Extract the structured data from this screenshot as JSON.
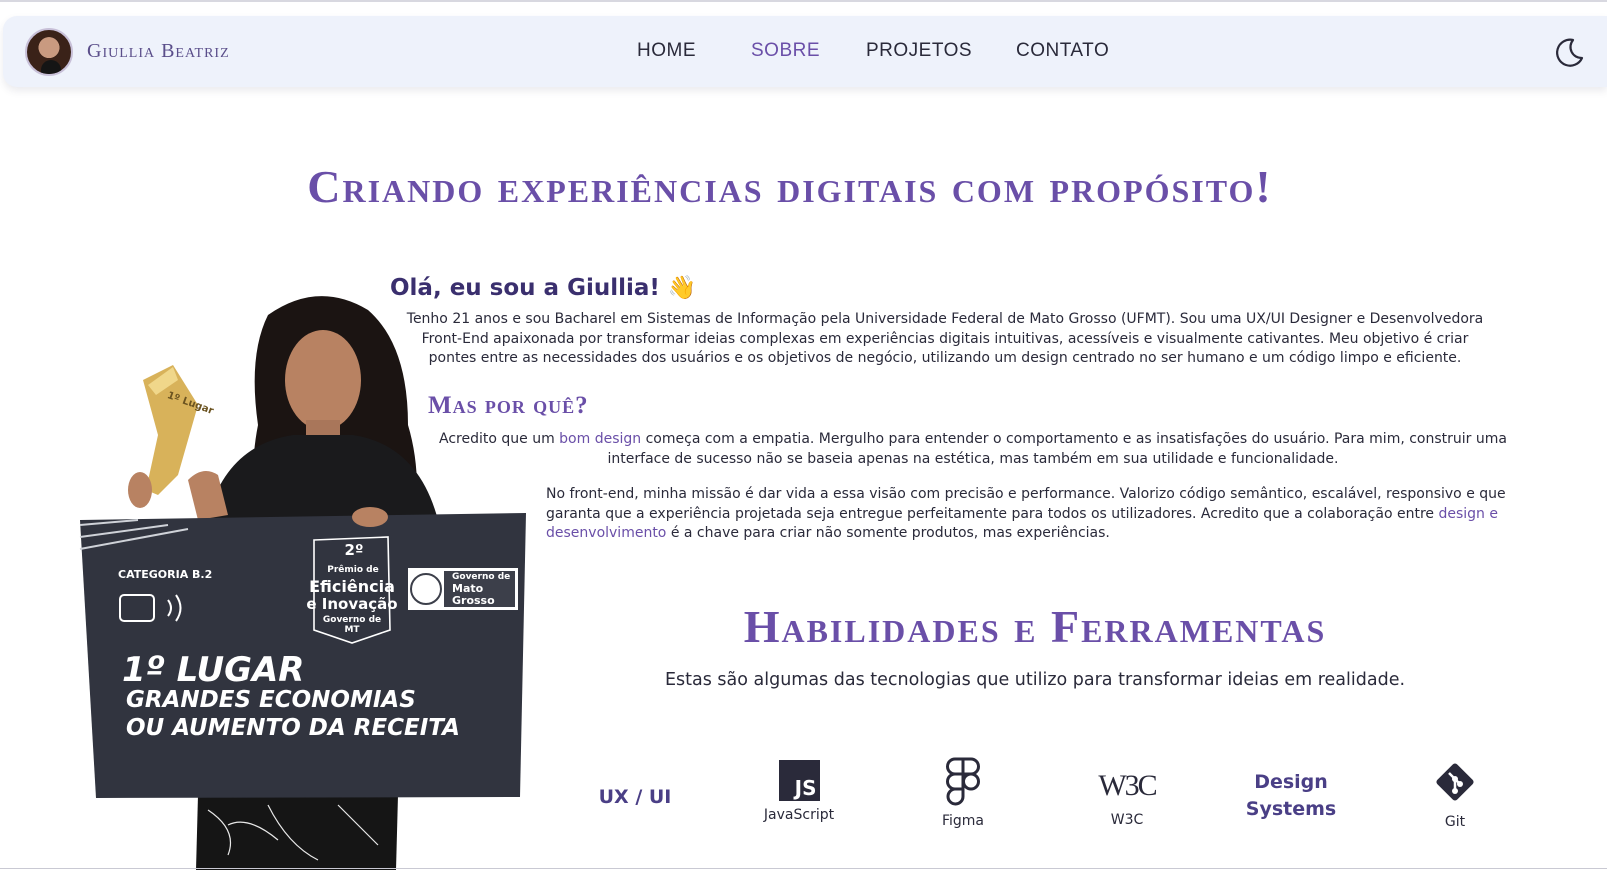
{
  "nav": {
    "brand": "Giullia Beatriz",
    "links": [
      {
        "label": "HOME"
      },
      {
        "label": "SOBRE"
      },
      {
        "label": "PROJETOS"
      },
      {
        "label": "CONTATO"
      }
    ],
    "active": "SOBRE",
    "theme_icon": "moon-icon"
  },
  "hero": {
    "title": "Criando experiências digitais com propósito!"
  },
  "photo": {
    "sign_category": "CATEGORIA B.2",
    "sign_line1": "1º LUGAR",
    "sign_line2": "GRANDES ECONOMIAS",
    "sign_line3": "OU AUMENTO DA RECEITA",
    "badge_rank": "2º",
    "badge_line1": "Prêmio de",
    "badge_line2": "Eficiência",
    "badge_line3": "e Inovação",
    "badge_line4": "Governo de MT",
    "gov_line1": "Governo de",
    "gov_line2": "Mato",
    "gov_line3": "Grosso",
    "trophy_label": "1º Lugar"
  },
  "about": {
    "greeting": "Olá, eu sou a Giullia! 👋",
    "paragraph1": "Tenho 21 anos e sou Bacharel em Sistemas de Informação pela Universidade Federal de Mato Grosso (UFMT). Sou uma UX/UI Designer e Desenvolvedora Front-End apaixonada por transformar ideias complexas em experiências digitais intuitivas, acessíveis e visualmente cativantes. Meu objetivo é criar pontes entre as necessidades dos usuários e os objetivos de negócio, utilizando um design centrado no ser humano e um código limpo e eficiente.",
    "subtitle": "Mas por quê?",
    "p2_before": "Acredito que um ",
    "p2_highlight": "bom design",
    "p2_after": " começa com a empatia. Mergulho para entender o comportamento e as insatisfações do usuário. Para mim, construir uma interface de sucesso não se baseia apenas na estética, mas também em sua utilidade e funcionalidade.",
    "p3_before": "No front-end, minha missão é dar vida a essa visão com precisão e performance. Valorizo código semântico, escalável, responsivo e que garanta que a experiência projetada seja entregue perfeitamente para todos os utilizadores. Acredito que a colaboração entre ",
    "p3_highlight": "design e desenvolvimento",
    "p3_after": " é a chave para criar não somente produtos, mas experiências."
  },
  "skills": {
    "title": "Habilidades e Ferramentas",
    "subtitle": "Estas são algumas das tecnologias que utilizo para transformar ideias em realidade.",
    "items": [
      {
        "label": "UX / UI",
        "icon": "ux-ui-text"
      },
      {
        "label": "JavaScript",
        "icon": "javascript-icon",
        "glyph": "JS"
      },
      {
        "label": "Figma",
        "icon": "figma-icon"
      },
      {
        "label": "W3C",
        "icon": "w3c-icon",
        "glyph": "W3C"
      },
      {
        "label": "Design Systems",
        "line1": "Design",
        "line2": "Systems",
        "icon": "design-systems-text"
      },
      {
        "label": "Git",
        "icon": "git-icon"
      }
    ]
  },
  "colors": {
    "accent": "#6a4fa8",
    "navbar_bg": "#eef2fb",
    "text": "#2a2a3a"
  }
}
